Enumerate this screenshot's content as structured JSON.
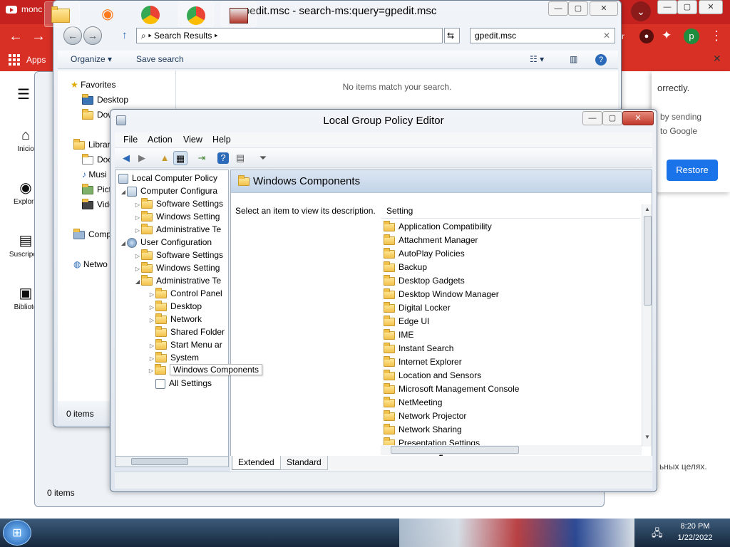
{
  "chrome": {
    "tab_title": "monc",
    "bookmarks_apps_label": "Apps",
    "avatar_letter": "p",
    "restore_dialog": {
      "line1": "orrectly.",
      "line2": "by sending",
      "line3": "to Google",
      "restore_label": "Restore"
    },
    "bottom_text": "ьных целях."
  },
  "youtube_sidebar": {
    "items": [
      {
        "label": "Inicio",
        "icon": "home-icon"
      },
      {
        "label": "Explora",
        "icon": "compass-icon"
      },
      {
        "label": "Suscripcio",
        "icon": "subscriptions-icon"
      },
      {
        "label": "Bibliote",
        "icon": "library-icon"
      }
    ]
  },
  "explorer": {
    "title": "gpedit.msc - search-ms:query=gpedit.msc",
    "address": "Search Results",
    "search_value": "gpedit.msc",
    "organize_label": "Organize",
    "save_search_label": "Save search",
    "empty_message": "No items match your search.",
    "nav": {
      "favorites": "Favorites",
      "desktop": "Desktop",
      "downloads": "Dow",
      "libraries": "Librar",
      "documents": "Docu",
      "music": "Musi",
      "pictures": "Pictu",
      "videos": "Vide",
      "computer": "Comp",
      "network": "Netwo"
    },
    "status": "0 items",
    "status_back": "0 items"
  },
  "gpe": {
    "title": "Local Group Policy Editor",
    "menu": [
      "File",
      "Action",
      "View",
      "Help"
    ],
    "tree": {
      "root": "Local Computer Policy",
      "computer_config": "Computer Configura",
      "cc_software": "Software Settings",
      "cc_windows": "Windows Setting",
      "cc_admin": "Administrative Te",
      "user_config": "User Configuration",
      "uc_software": "Software Settings",
      "uc_windows": "Windows Setting",
      "uc_admin": "Administrative Te",
      "control_panel": "Control Panel",
      "desktop": "Desktop",
      "network": "Network",
      "shared_folders": "Shared Folder",
      "start_menu": "Start Menu ar",
      "system": "System",
      "windows_components": "Windows Components",
      "all_settings": "All Settings"
    },
    "header_title": "Windows Components",
    "description": "Select an item to view its description.",
    "column_setting": "Setting",
    "settings": [
      "Application Compatibility",
      "Attachment Manager",
      "AutoPlay Policies",
      "Backup",
      "Desktop Gadgets",
      "Desktop Window Manager",
      "Digital Locker",
      "Edge UI",
      "IME",
      "Instant Search",
      "Internet Explorer",
      "Location and Sensors",
      "Microsoft Management Console",
      "NetMeeting",
      "Network Projector",
      "Network Sharing",
      "Presentation Settings"
    ],
    "tabs": [
      "Extended",
      "Standard"
    ]
  },
  "taskbar": {
    "time": "8:20 PM",
    "date": "1/22/2022"
  }
}
